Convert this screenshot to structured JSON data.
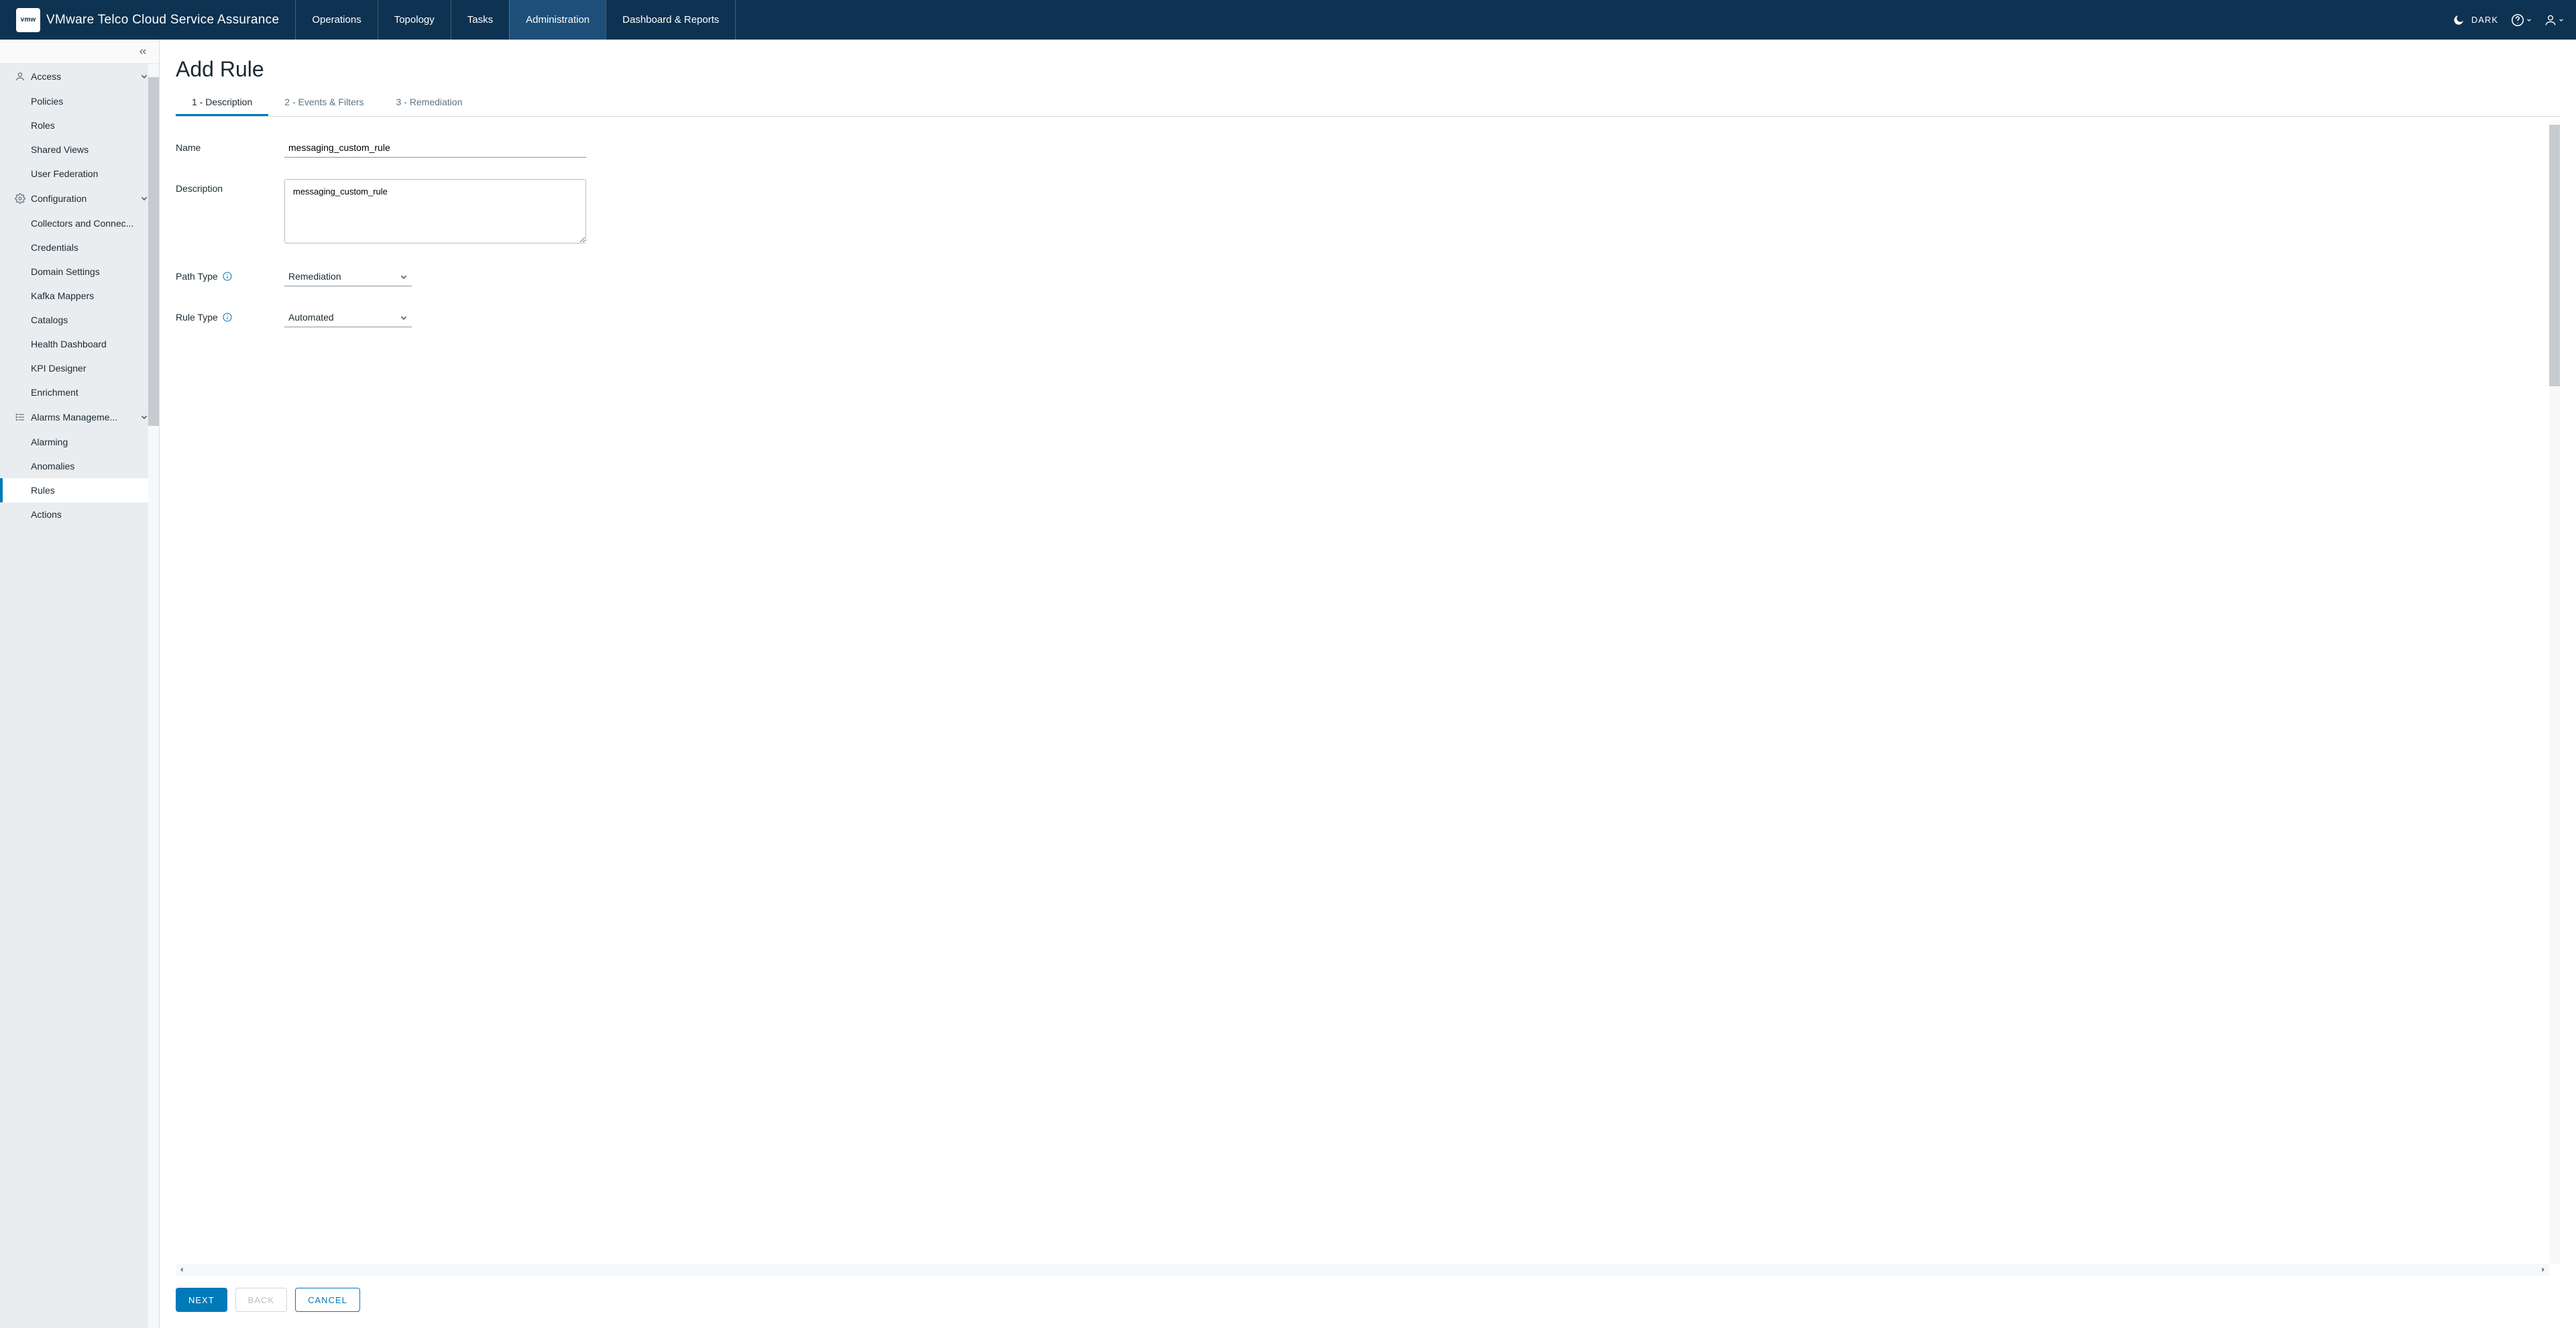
{
  "brand": {
    "logo_text": "vmw",
    "app_title": "VMware Telco Cloud Service Assurance"
  },
  "top_nav": {
    "items": [
      {
        "label": "Operations"
      },
      {
        "label": "Topology"
      },
      {
        "label": "Tasks"
      },
      {
        "label": "Administration"
      },
      {
        "label": "Dashboard & Reports"
      }
    ],
    "active_index": 3
  },
  "theme": {
    "label": "DARK"
  },
  "sidebar": {
    "sections": [
      {
        "label": "Access",
        "items": [
          {
            "label": "Policies"
          },
          {
            "label": "Roles"
          },
          {
            "label": "Shared Views"
          },
          {
            "label": "User Federation"
          }
        ]
      },
      {
        "label": "Configuration",
        "items": [
          {
            "label": "Collectors and Connec..."
          },
          {
            "label": "Credentials"
          },
          {
            "label": "Domain Settings"
          },
          {
            "label": "Kafka Mappers"
          },
          {
            "label": "Catalogs"
          },
          {
            "label": "Health Dashboard"
          },
          {
            "label": "KPI Designer"
          },
          {
            "label": "Enrichment"
          }
        ]
      },
      {
        "label": "Alarms Manageme...",
        "items": [
          {
            "label": "Alarming"
          },
          {
            "label": "Anomalies"
          },
          {
            "label": "Rules"
          },
          {
            "label": "Actions"
          }
        ]
      }
    ],
    "selected_path": "2.2"
  },
  "page": {
    "title": "Add Rule",
    "tabs": [
      {
        "label": "1 - Description"
      },
      {
        "label": "2 - Events & Filters"
      },
      {
        "label": "3 - Remediation"
      }
    ],
    "active_tab": 0
  },
  "form": {
    "name_label": "Name",
    "name_value": "messaging_custom_rule",
    "description_label": "Description",
    "description_value": "messaging_custom_rule",
    "path_type_label": "Path Type",
    "path_type_value": "Remediation",
    "rule_type_label": "Rule Type",
    "rule_type_value": "Automated"
  },
  "footer": {
    "next": "Next",
    "back": "Back",
    "cancel": "Cancel"
  }
}
